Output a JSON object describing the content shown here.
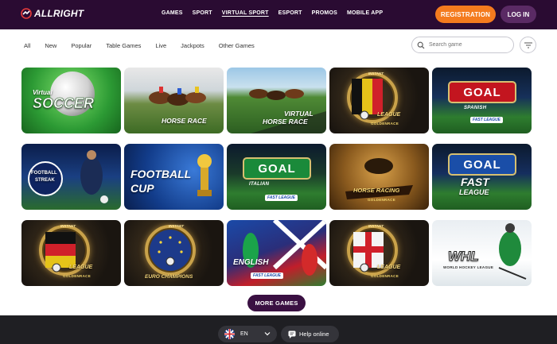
{
  "header": {
    "logo_text": "ALLRIGHT",
    "nav": [
      {
        "label": "GAMES",
        "active": false
      },
      {
        "label": "SPORT",
        "active": false
      },
      {
        "label": "VIRTUAL SPORT",
        "active": true
      },
      {
        "label": "ESPORT",
        "active": false
      },
      {
        "label": "PROMOS",
        "active": false
      },
      {
        "label": "MOBILE APP",
        "active": false
      }
    ],
    "register_label": "REGISTRATION",
    "login_label": "LOG IN"
  },
  "filters": [
    "All",
    "New",
    "Popular",
    "Table Games",
    "Live",
    "Jackpots",
    "Other Games"
  ],
  "search": {
    "placeholder": "Search game"
  },
  "games": [
    {
      "title": "SOCCER",
      "pre": "Virtual"
    },
    {
      "title": "HORSE RACE"
    },
    {
      "title_line1": "VIRTUAL",
      "title_line2": "HORSE RACE"
    },
    {
      "badge": "INSTANT",
      "title": "LEAGUE",
      "sub": "GOLDENRACE"
    },
    {
      "title": "GOAL",
      "sub": "SPANISH",
      "fast": "FAST LEAGUE"
    },
    {
      "title_line1": "FOOTBALL",
      "title_line2": "STREAK"
    },
    {
      "title_line1": "FOOTBALL",
      "title_line2": "CUP"
    },
    {
      "title": "GOAL",
      "sub": "ITALIAN",
      "fast": "FAST LEAGUE"
    },
    {
      "title": "HORSE RACING",
      "sub": "GOLDENRACE"
    },
    {
      "title": "GOAL",
      "sub": "FAST",
      "fast": "LEAGUE"
    },
    {
      "badge": "INSTANT",
      "title": "LEAGUE",
      "sub": "GOLDENRACE"
    },
    {
      "badge": "INSTANT",
      "title": "EURO CHAMPIONS"
    },
    {
      "title": "ENGLISH",
      "fast": "FAST LEAGUE"
    },
    {
      "badge": "INSTANT",
      "title": "LEAGUE",
      "sub": "GOLDENRACE"
    },
    {
      "title": "WHL",
      "sub": "WORLD HOCKEY LEAGUE"
    }
  ],
  "more_label": "MORE GAMES",
  "footer": {
    "language": "EN",
    "help_label": "Help online"
  },
  "colors": {
    "header_bg": "#2a0b32",
    "accent_orange": "#f47b1e",
    "login_bg": "#5a2a64",
    "more_bg": "#3a1042",
    "footer_bg": "#1f1f23"
  }
}
